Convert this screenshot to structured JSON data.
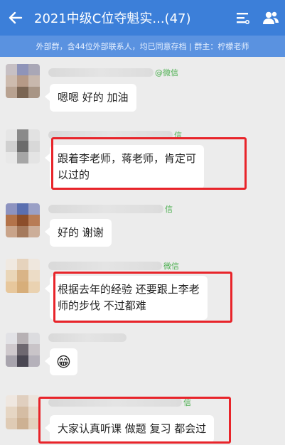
{
  "header": {
    "title": "2021中级C位夺魁实...(47)",
    "back_icon": "arrow-left-icon",
    "menu_icon": "list-menu-icon",
    "members_icon": "group-members-icon",
    "bg_color": "#3c7fd9"
  },
  "notice": {
    "text": "外部群，含44位外部联系人，均已同意存档 | 群主：柠檬老师"
  },
  "messages": [
    {
      "sender_tag": "@微信",
      "text": "嗯嗯 好的 加油"
    },
    {
      "sender_tag": "信",
      "text_line1": "跟着李老师，蒋老师，肯定可",
      "text_line2": "以过的",
      "highlighted": true
    },
    {
      "sender_tag": "信",
      "text": "好的 谢谢"
    },
    {
      "sender_tag": "微信",
      "text_line1": "根据去年的经验 还要跟上李老",
      "text_line2": "师的步伐 不过都难",
      "highlighted": true
    },
    {
      "sender_tag": "",
      "emoji": "😁"
    },
    {
      "sender_tag": "信",
      "text": "大家认真听课 做题 复习 都会过",
      "highlighted": true
    }
  ],
  "colors": {
    "highlight": "#e8242a",
    "wechat_tag": "#4caf50"
  }
}
